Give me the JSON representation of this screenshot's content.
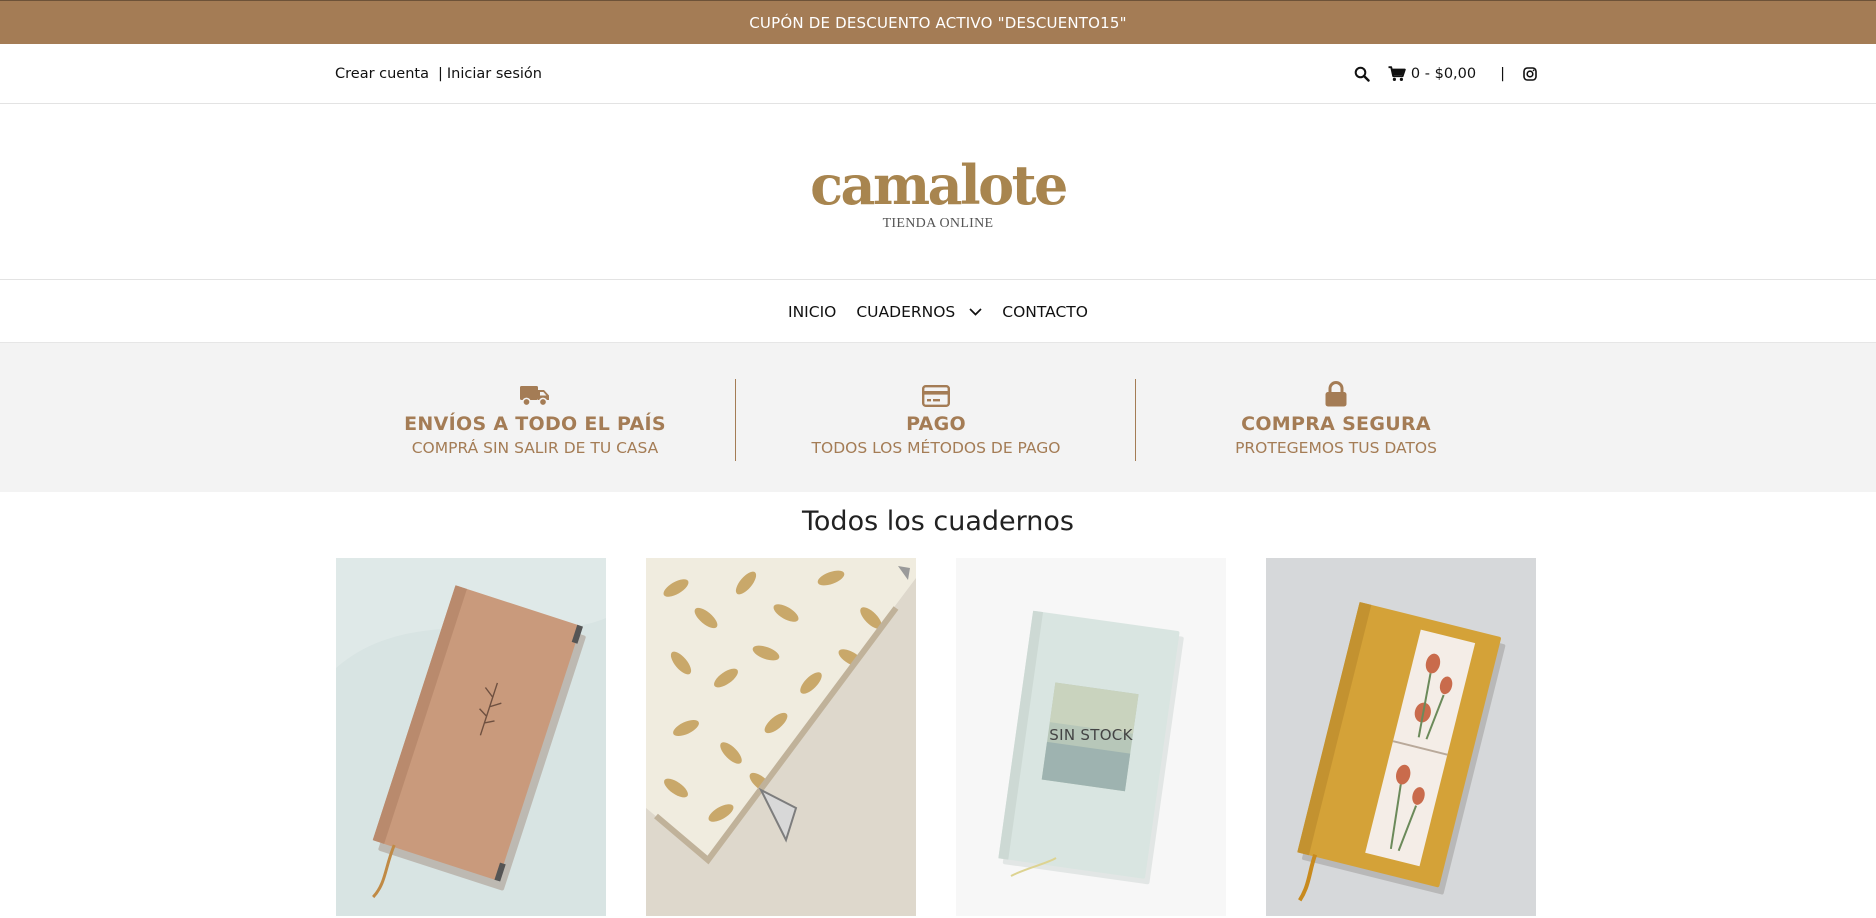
{
  "promo": {
    "text": "CUPÓN DE DESCUENTO ACTIVO \"DESCUENTO15\""
  },
  "account": {
    "create_label": "Crear cuenta",
    "separator": "|",
    "login_label": "Iniciar sesión"
  },
  "header": {
    "search_icon": "search-icon",
    "cart_icon": "cart-icon",
    "cart_summary": "0 - $0,00",
    "separator": "|",
    "instagram_icon": "instagram-icon"
  },
  "logo": {
    "wordmark": "camalote",
    "subtitle": "TIENDA ONLINE",
    "color": "#a8854f"
  },
  "nav": {
    "items": [
      {
        "label": "INICIO"
      },
      {
        "label": "CUADERNOS",
        "has_dropdown": true
      },
      {
        "label": "CONTACTO"
      }
    ]
  },
  "benefits": [
    {
      "icon": "truck-icon",
      "title": "ENVÍOS A TODO EL PAÍS",
      "subtitle": "COMPRÁ SIN SALIR DE TU CASA"
    },
    {
      "icon": "credit-card-icon",
      "title": "PAGO",
      "subtitle": "TODOS LOS MÉTODOS DE PAGO"
    },
    {
      "icon": "lock-icon",
      "title": "COMPRA SEGURA",
      "subtitle": "PROTEGEMOS TUS DATOS"
    }
  ],
  "section": {
    "title": "Todos los cuadernos"
  },
  "products": [
    {
      "image": "tan-notebook-sprig",
      "badge": ""
    },
    {
      "image": "leaf-pattern-notebook",
      "badge": ""
    },
    {
      "image": "mint-notebook-painting",
      "badge": "SIN STOCK"
    },
    {
      "image": "mustard-notebook-tulips",
      "badge": ""
    }
  ],
  "colors": {
    "accent": "#a47c55",
    "benefits_bg": "#f3f3f3"
  }
}
